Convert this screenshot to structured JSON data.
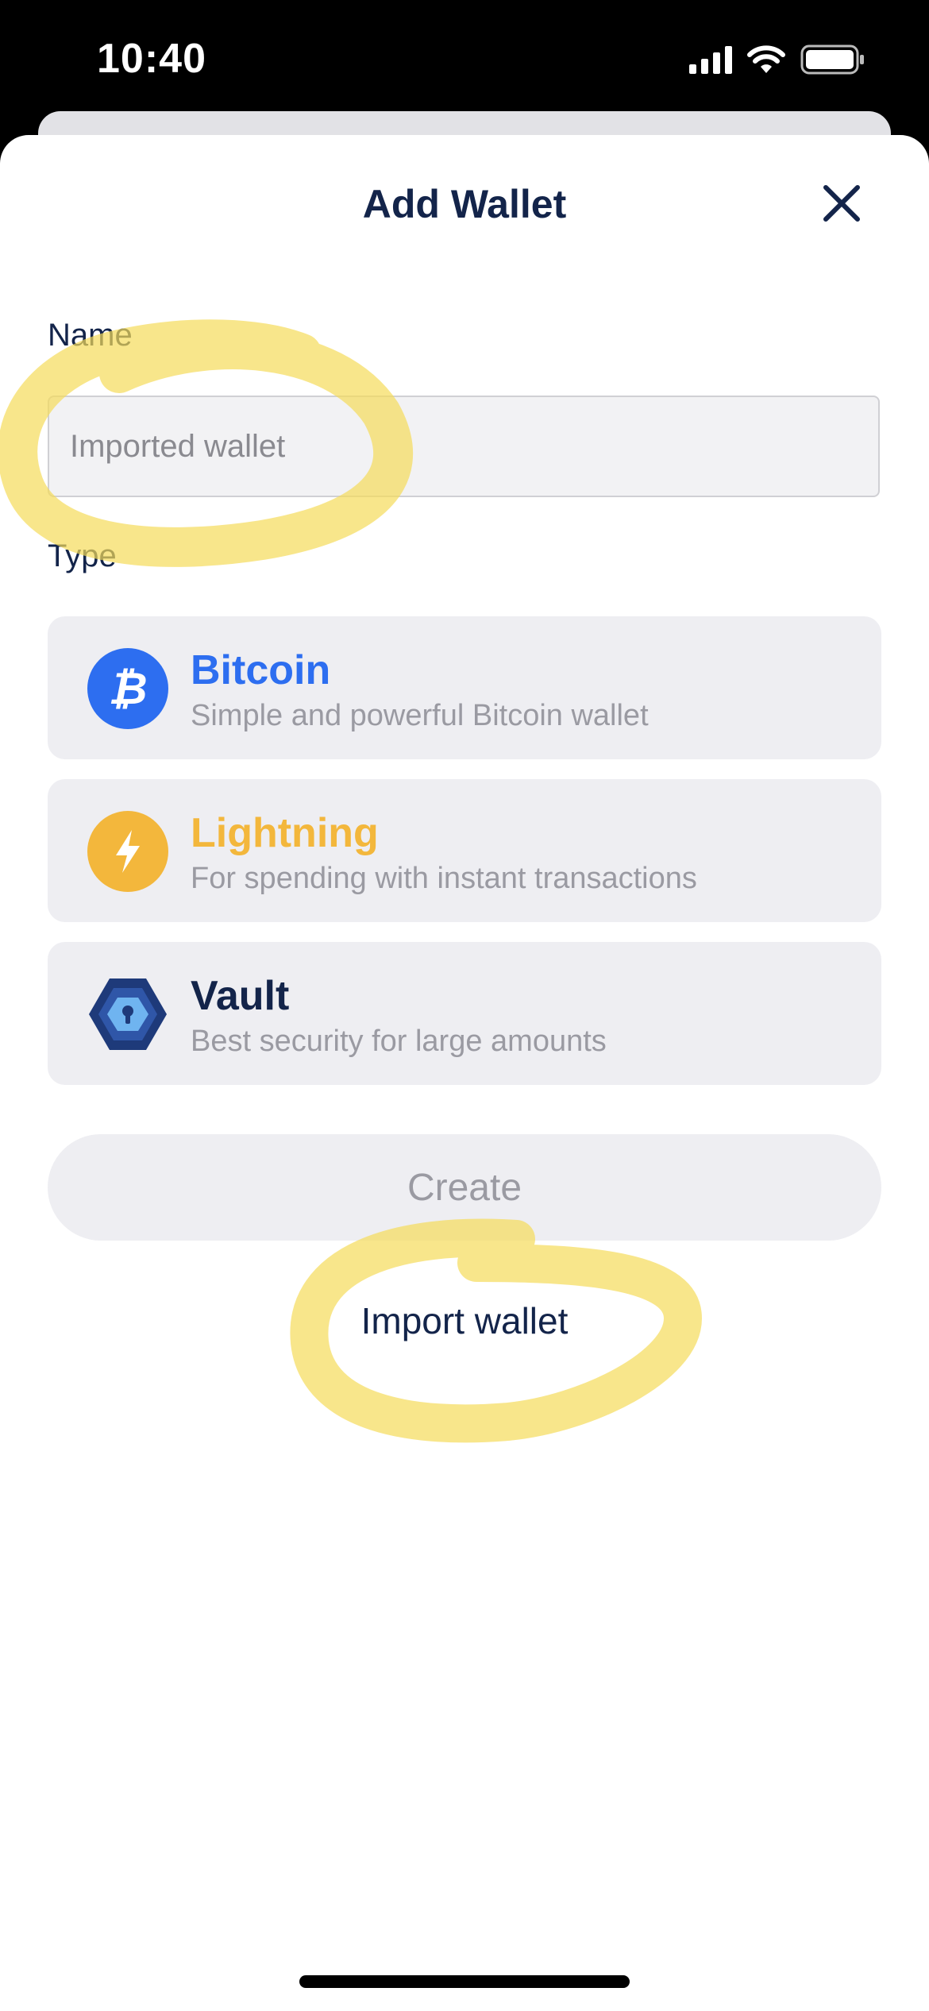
{
  "status_bar": {
    "time": "10:40",
    "icons": [
      "cellular-signal-icon",
      "wifi-icon",
      "battery-icon"
    ]
  },
  "sheet": {
    "title": "Add Wallet",
    "close_icon": "close-icon"
  },
  "name_field": {
    "label": "Name",
    "placeholder": "Imported wallet",
    "value": ""
  },
  "type_section": {
    "label": "Type",
    "options": [
      {
        "title": "Bitcoin",
        "description": "Simple and powerful Bitcoin wallet",
        "icon": "bitcoin-icon",
        "color": "#2d6ef0"
      },
      {
        "title": "Lightning",
        "description": "For spending with instant transactions",
        "icon": "lightning-icon",
        "color": "#f3b73c"
      },
      {
        "title": "Vault",
        "description": "Best security for large amounts",
        "icon": "vault-icon",
        "color": "#13244a"
      }
    ]
  },
  "actions": {
    "create_label": "Create",
    "import_label": "Import wallet"
  },
  "colors": {
    "primary_text": "#13244a",
    "bitcoin": "#2d6ef0",
    "lightning": "#f3b73c",
    "card_background": "#eeeef2",
    "highlight_annotation": "#f5dc5a"
  }
}
